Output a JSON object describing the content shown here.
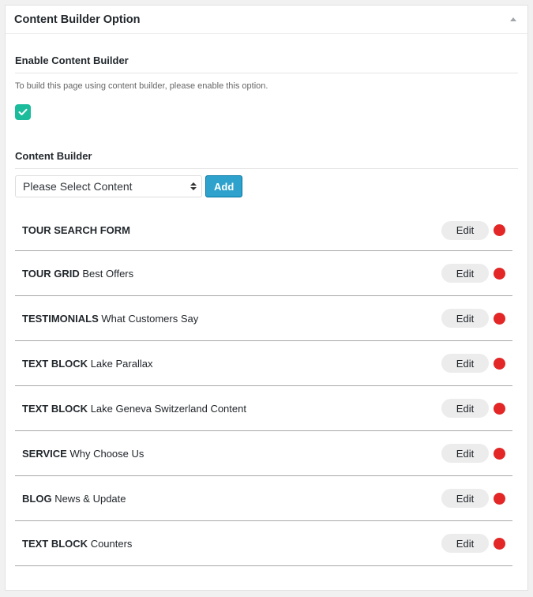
{
  "panel": {
    "title": "Content Builder Option"
  },
  "enable_section": {
    "heading": "Enable Content Builder",
    "description": "To build this page using content builder, please enable this option.",
    "checked": true
  },
  "builder_section": {
    "heading": "Content Builder",
    "select_value": "Please Select Content",
    "add_label": "Add"
  },
  "items": [
    {
      "type": "TOUR SEARCH FORM",
      "name": "",
      "edit_label": "Edit"
    },
    {
      "type": "TOUR GRID",
      "name": "Best Offers",
      "edit_label": "Edit"
    },
    {
      "type": "TESTIMONIALS",
      "name": "What Customers Say",
      "edit_label": "Edit"
    },
    {
      "type": "TEXT BLOCK",
      "name": "Lake Parallax",
      "edit_label": "Edit"
    },
    {
      "type": "TEXT BLOCK",
      "name": "Lake Geneva Switzerland Content",
      "edit_label": "Edit"
    },
    {
      "type": "SERVICE",
      "name": "Why Choose Us",
      "edit_label": "Edit"
    },
    {
      "type": "BLOG",
      "name": "News & Update",
      "edit_label": "Edit"
    },
    {
      "type": "TEXT BLOCK",
      "name": "Counters",
      "edit_label": "Edit"
    }
  ],
  "colors": {
    "checkbox": "#1abc9c",
    "add_button": "#2ea2cc",
    "remove_dot": "#e32626"
  },
  "icons": {
    "collapse": "triangle-up-icon",
    "checkbox": "checkmark-icon",
    "select": "select-arrows-icon",
    "remove": "red-dot-icon"
  }
}
